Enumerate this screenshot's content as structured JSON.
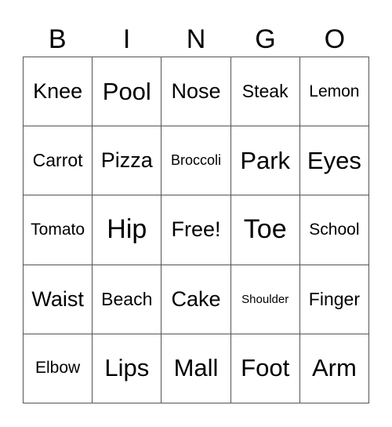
{
  "header": [
    "B",
    "I",
    "N",
    "G",
    "O"
  ],
  "cells": [
    {
      "text": "Knee",
      "size": "s-m"
    },
    {
      "text": "Pool",
      "size": "s-l"
    },
    {
      "text": "Nose",
      "size": "s-m"
    },
    {
      "text": "Steak",
      "size": "s-sm"
    },
    {
      "text": "Lemon",
      "size": "s-s"
    },
    {
      "text": "Carrot",
      "size": "s-sm"
    },
    {
      "text": "Pizza",
      "size": "s-m"
    },
    {
      "text": "Broccoli",
      "size": "s-xs"
    },
    {
      "text": "Park",
      "size": "s-l"
    },
    {
      "text": "Eyes",
      "size": "s-l"
    },
    {
      "text": "Tomato",
      "size": "s-s"
    },
    {
      "text": "Hip",
      "size": "s-xl"
    },
    {
      "text": "Free!",
      "size": "s-m"
    },
    {
      "text": "Toe",
      "size": "s-xl"
    },
    {
      "text": "School",
      "size": "s-s"
    },
    {
      "text": "Waist",
      "size": "s-m"
    },
    {
      "text": "Beach",
      "size": "s-sm"
    },
    {
      "text": "Cake",
      "size": "s-m"
    },
    {
      "text": "Shoulder",
      "size": "s-xxs"
    },
    {
      "text": "Finger",
      "size": "s-sm"
    },
    {
      "text": "Elbow",
      "size": "s-s"
    },
    {
      "text": "Lips",
      "size": "s-l"
    },
    {
      "text": "Mall",
      "size": "s-l"
    },
    {
      "text": "Foot",
      "size": "s-l"
    },
    {
      "text": "Arm",
      "size": "s-l"
    }
  ]
}
